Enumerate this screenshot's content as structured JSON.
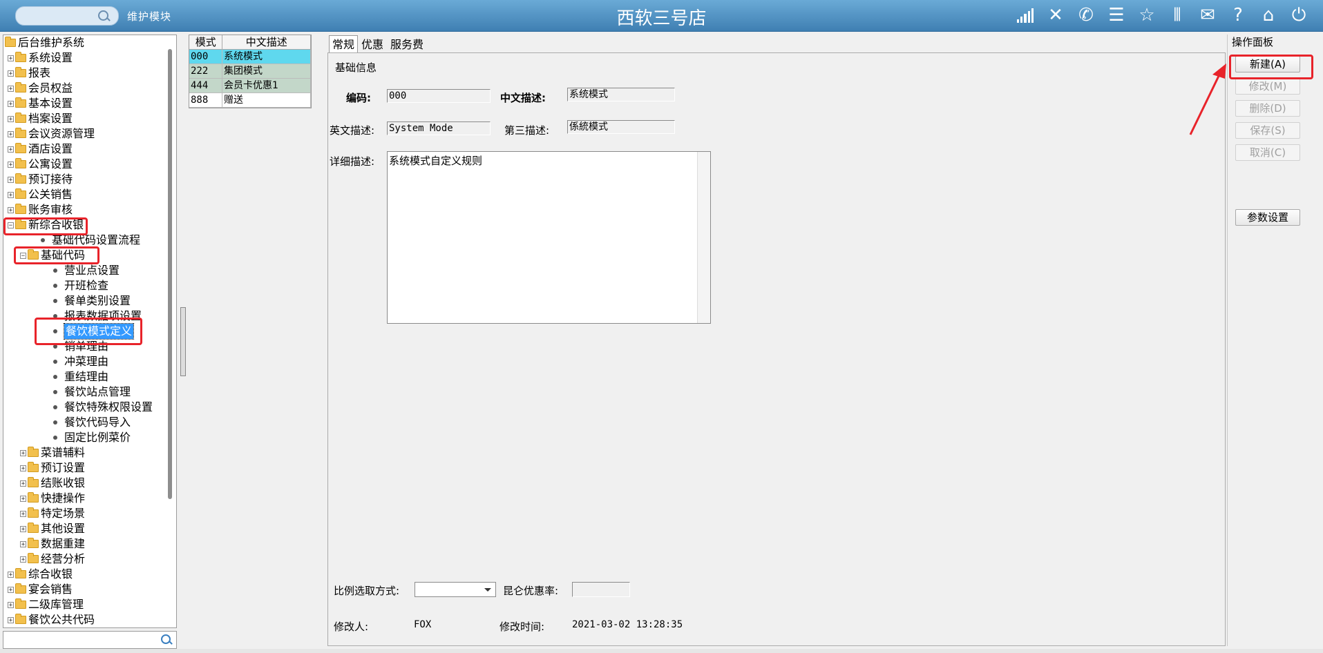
{
  "header": {
    "module_label": "维护模块",
    "store_name": "西软三号店",
    "icons": [
      "signal-icon",
      "tools-icon",
      "phone-icon",
      "menu-icon",
      "star-icon",
      "columns-icon",
      "mail-icon",
      "help-icon",
      "home-icon",
      "power-icon"
    ]
  },
  "tree": {
    "root": "后台维护系统",
    "items": [
      {
        "label": "系统设置",
        "expanded": false
      },
      {
        "label": "报表",
        "expanded": false
      },
      {
        "label": "会员权益",
        "expanded": false
      },
      {
        "label": "基本设置",
        "expanded": false
      },
      {
        "label": "档案设置",
        "expanded": false
      },
      {
        "label": "会议资源管理",
        "expanded": false
      },
      {
        "label": "酒店设置",
        "expanded": false
      },
      {
        "label": "公寓设置",
        "expanded": false
      },
      {
        "label": "预订接待",
        "expanded": false
      },
      {
        "label": "公关销售",
        "expanded": false
      },
      {
        "label": "账务审核",
        "expanded": false
      },
      {
        "label": "新综合收银",
        "expanded": true
      },
      {
        "label": "基础代码设置流程",
        "leaf": true
      },
      {
        "label": "基础代码",
        "expanded": true
      },
      {
        "label": "营业点设置",
        "leaf": true
      },
      {
        "label": "开班检查",
        "leaf": true
      },
      {
        "label": "餐单类别设置",
        "leaf": true
      },
      {
        "label": "报表数据项设置",
        "leaf": true
      },
      {
        "label": "餐饮模式定义",
        "leaf": true,
        "selected": true
      },
      {
        "label": "销单理由",
        "leaf": true
      },
      {
        "label": "冲菜理由",
        "leaf": true
      },
      {
        "label": "重结理由",
        "leaf": true
      },
      {
        "label": "餐饮站点管理",
        "leaf": true
      },
      {
        "label": "餐饮特殊权限设置",
        "leaf": true
      },
      {
        "label": "餐饮代码导入",
        "leaf": true
      },
      {
        "label": "固定比例菜价",
        "leaf": true
      },
      {
        "label": "菜谱辅料",
        "expanded": false
      },
      {
        "label": "预订设置",
        "expanded": false
      },
      {
        "label": "结账收银",
        "expanded": false
      },
      {
        "label": "快捷操作",
        "expanded": false
      },
      {
        "label": "特定场景",
        "expanded": false
      },
      {
        "label": "其他设置",
        "expanded": false
      },
      {
        "label": "数据重建",
        "expanded": false
      },
      {
        "label": "经营分析",
        "expanded": false
      },
      {
        "label": "综合收银",
        "expanded": false
      },
      {
        "label": "宴会销售",
        "expanded": false
      },
      {
        "label": "二级库管理",
        "expanded": false
      },
      {
        "label": "餐饮公共代码",
        "expanded": false
      }
    ]
  },
  "mode_grid": {
    "headers": [
      "模式",
      "中文描述"
    ],
    "rows": [
      {
        "code": "000",
        "desc": "系统模式"
      },
      {
        "code": "222",
        "desc": "集团模式"
      },
      {
        "code": "444",
        "desc": "会员卡优惠1"
      },
      {
        "code": "888",
        "desc": "赠送"
      }
    ]
  },
  "tabs": [
    "常规",
    "优惠",
    "服务费"
  ],
  "form": {
    "section_title": "基础信息",
    "code_label": "编码:",
    "code_value": "000",
    "cn_desc_label": "中文描述:",
    "cn_desc_value": "系统模式",
    "en_desc_label": "英文描述:",
    "en_desc_value": "System Mode",
    "third_desc_label": "第三描述:",
    "third_desc_value": "係統模式",
    "detail_label": "详细描述:",
    "detail_value": "系统模式自定义规则",
    "ratio_label": "比例选取方式:",
    "ratio_value": "",
    "kunlun_label": "昆仑优惠率:",
    "kunlun_value": "",
    "modifier_label": "修改人:",
    "modifier_value": "FOX",
    "modtime_label": "修改时间:",
    "modtime_value": "2021-03-02 13:28:35"
  },
  "op_panel": {
    "title": "操作面板",
    "new_label": "新建(A)",
    "modify_label": "修改(M)",
    "delete_label": "删除(D)",
    "save_label": "保存(S)",
    "cancel_label": "取消(C)",
    "params_label": "参数设置"
  },
  "colors": {
    "header_bg": "#4a8cc0",
    "highlight_red": "#e8232a",
    "selection_blue": "#3399ff",
    "grid_selected": "#5fd8ee"
  }
}
